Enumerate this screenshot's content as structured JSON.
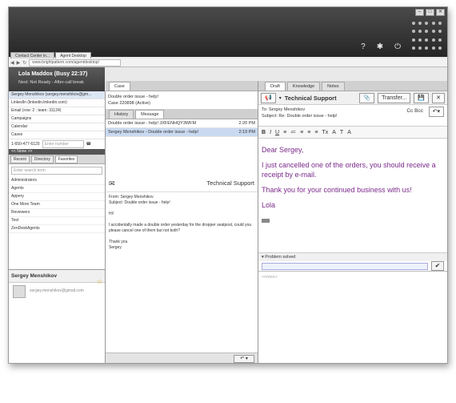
{
  "browser": {
    "tabs": [
      "Contact Center in...",
      "Agent Desktop"
    ],
    "url": "www.brightpattern.com/agentdesktop/",
    "window_controls": [
      "–",
      "□",
      "✕"
    ]
  },
  "header": {
    "icons": [
      "help-icon",
      "settings-icon",
      "power-icon"
    ],
    "help_glyph": "?",
    "settings_glyph": "✱",
    "power_glyph": "⏻"
  },
  "agent": {
    "name": "Lola Maddox  (Busy 22:37)",
    "status": "Next: Not Ready - After-call break"
  },
  "left_panel": {
    "items": [
      "Sergey Menshikov (sergey.menshikov@gm...",
      "LinkedIn (linkedin.linkedin.com)",
      "Email (row: 2 ; team: 31124)",
      "Campaigns",
      "Calendar",
      "Cases"
    ],
    "phone_number": "1-650-477-6120",
    "extension_placeholder": "Enter number",
    "none_label": "<< None >>",
    "directory_tabs": [
      "Recent",
      "Directory",
      "Favorites"
    ],
    "search_placeholder": "Enter search term",
    "tree": [
      "Administrators",
      "Agents",
      "Appery",
      "One More Team",
      "Reviewers",
      "Test",
      "ZenDeskAgents"
    ],
    "contact": {
      "name": "Sergey Menshikov",
      "email": "sergey.menshikov@gmail.com"
    }
  },
  "case_panel": {
    "tab": "Case",
    "line1": "Double order issue - help!",
    "line2": "Case 220898 (Active)",
    "sub_tabs": [
      "History",
      "Message"
    ],
    "history": [
      {
        "subject": "Double order issue - help! JXFENHQY3WFM",
        "time": "2:20 PM"
      },
      {
        "subject": "Sergey Menshikov - Double order issue - help!",
        "time": "2:19 PM"
      }
    ]
  },
  "message": {
    "title": "Technical Support",
    "from": "From: Sergey Menshikov",
    "subject": "Subject: Double order issue - help!",
    "greeting": "Hi!",
    "body": "I accidentally made a double order yesterday for the dropper seatpost, could you please cancel one of them but not both?",
    "thanks": "Thank you",
    "signature": "Sergey"
  },
  "draft_panel": {
    "tabs": [
      "Draft",
      "Knowledge",
      "Notes"
    ],
    "queue": "Technical Support",
    "transfer_label": "Transfer...",
    "to": "To: Sergey Menshikov",
    "subject": "Subject: Re: Double order issue - help!",
    "ccbcc": "Cc Bcc",
    "format_buttons": [
      "B",
      "I",
      "U",
      "≡",
      "≔",
      "≡",
      "≡",
      "≡",
      "Tx",
      "A",
      "T",
      "A"
    ],
    "compose": {
      "greeting": "Dear Sergey,",
      "p1": "I just cancelled one of the orders, you should receive a receipt by e-mail.",
      "p2": "Thank you for your continued business with us!",
      "sign": "Lola"
    },
    "resolution": "Problem solved",
    "notes_placeholder": "<notes>"
  },
  "colors": {
    "compose_text": "#7a2a8a",
    "selection": "#c9d9f0",
    "chrome_dark": "#262626"
  }
}
